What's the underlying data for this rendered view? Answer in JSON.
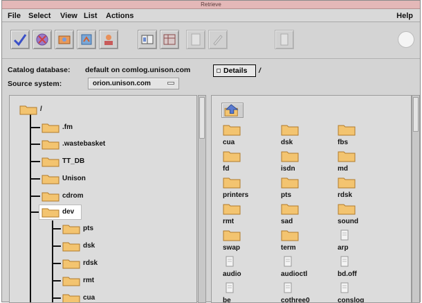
{
  "window": {
    "title": "Retrieve"
  },
  "menu": {
    "file": "File",
    "select": "Select",
    "view": "View",
    "list": "List",
    "actions": "Actions",
    "help": "Help"
  },
  "toolbar": {
    "buttons": [
      "check-icon",
      "restore-icon",
      "ticket-icon",
      "refresh-icon",
      "user-icon",
      "book-icon",
      "table-icon",
      "document-icon",
      "edit-icon",
      "file-icon"
    ]
  },
  "catalog": {
    "label": "Catalog database:",
    "value": "default on comlog.unison.com"
  },
  "source": {
    "label": "Source system:",
    "value": "orion.unison.com"
  },
  "details": {
    "label": "Details",
    "path": "/"
  },
  "tree": {
    "root": "/",
    "items": [
      ".fm",
      ".wastebasket",
      "TT_DB",
      "Unison",
      "cdrom",
      "dev"
    ],
    "dev_children": [
      "pts",
      "dsk",
      "rdsk",
      "rmt",
      "cua"
    ]
  },
  "grid": {
    "items": [
      {
        "label": "cua",
        "type": "folder"
      },
      {
        "label": "dsk",
        "type": "folder"
      },
      {
        "label": "fbs",
        "type": "folder"
      },
      {
        "label": "fd",
        "type": "folder"
      },
      {
        "label": "isdn",
        "type": "folder"
      },
      {
        "label": "md",
        "type": "folder"
      },
      {
        "label": "printers",
        "type": "folder"
      },
      {
        "label": "pts",
        "type": "folder"
      },
      {
        "label": "rdsk",
        "type": "folder"
      },
      {
        "label": "rmt",
        "type": "folder"
      },
      {
        "label": "sad",
        "type": "folder"
      },
      {
        "label": "sound",
        "type": "folder"
      },
      {
        "label": "swap",
        "type": "folder"
      },
      {
        "label": "term",
        "type": "folder"
      },
      {
        "label": "arp",
        "type": "file"
      },
      {
        "label": "audio",
        "type": "file"
      },
      {
        "label": "audioctl",
        "type": "file"
      },
      {
        "label": "bd.off",
        "type": "file"
      },
      {
        "label": "be",
        "type": "file"
      },
      {
        "label": "cothree0",
        "type": "file"
      },
      {
        "label": "conslog",
        "type": "file"
      }
    ]
  },
  "colors": {
    "folder": "#f3c470",
    "folder_edge": "#b07a2a",
    "titlebar": "#e4b8b8"
  }
}
